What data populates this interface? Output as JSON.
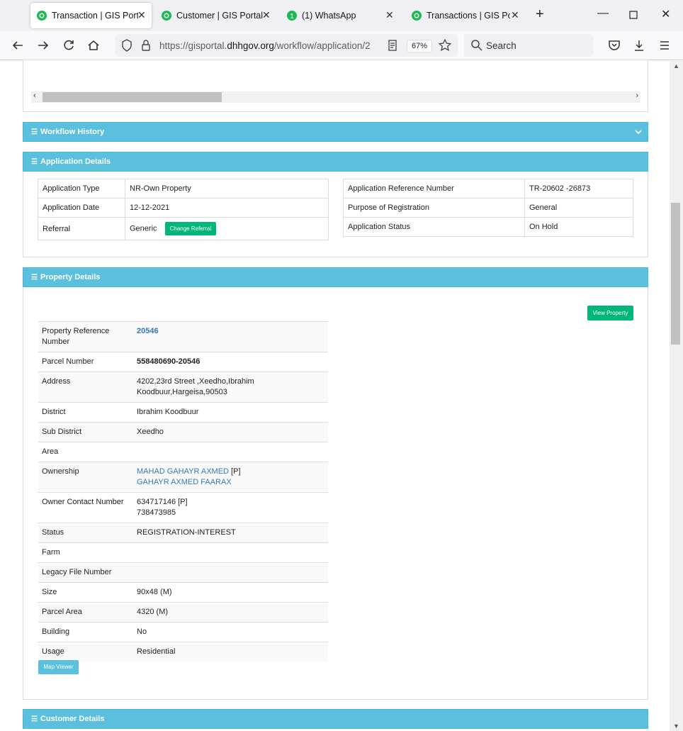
{
  "tabs": [
    {
      "title": "Transaction | GIS Portal",
      "active": true
    },
    {
      "title": "Customer | GIS Portal",
      "active": false
    },
    {
      "title": "(1) WhatsApp",
      "active": false,
      "badge": "1"
    },
    {
      "title": "Transactions | GIS Portal",
      "active": false
    }
  ],
  "address_bar": {
    "url_prefix": "https://gisportal.",
    "url_domain": "dhhgov.org",
    "url_path": "/workflow/application/2",
    "zoom": "67%"
  },
  "search": {
    "placeholder": "Search"
  },
  "workflow_history": {
    "title": "Workflow History"
  },
  "application_details": {
    "title": "Application Details",
    "left": [
      {
        "label": "Application Type",
        "value": "NR-Own Property"
      },
      {
        "label": "Application Date",
        "value": "12-12-2021"
      },
      {
        "label": "Referral",
        "value": "Generic",
        "button": "Change Referral"
      }
    ],
    "right": [
      {
        "label": "Application Reference Number",
        "value": "TR-20602 -26873"
      },
      {
        "label": "Purpose of Registration",
        "value": "General"
      },
      {
        "label": "Application Status",
        "value": "On Hold"
      }
    ]
  },
  "property_details": {
    "title": "Property Details",
    "view_button": "View Property",
    "map_button": "Map Viewer",
    "rows": [
      {
        "label": "Property Reference Number",
        "value": "20546"
      },
      {
        "label": "Parcel Number",
        "value": "558480690-20546"
      },
      {
        "label": "Address",
        "value": "4202,23rd Street ,Xeedho,Ibrahim Koodbuur,Hargeisa,90503"
      },
      {
        "label": "District",
        "value": "Ibrahim Koodbuur"
      },
      {
        "label": "Sub District",
        "value": "Xeedho"
      },
      {
        "label": "Area",
        "value": ""
      },
      {
        "label": "Ownership",
        "owners": [
          {
            "name": "MAHAD GAHAYR AXMED",
            "tag": " [P]"
          },
          {
            "name": "GAHAYR AXMED FAARAX",
            "tag": ""
          }
        ]
      },
      {
        "label": "Owner Contact Number",
        "contacts": [
          "634717146 [P]",
          "738473985"
        ]
      },
      {
        "label": "Status",
        "value": "REGISTRATION-INTEREST"
      },
      {
        "label": "Farm",
        "value": ""
      },
      {
        "label": "Legacy File Number",
        "value": ""
      },
      {
        "label": "Size",
        "value": "90x48 (M)"
      },
      {
        "label": "Parcel Area",
        "value": "4320 (M)"
      },
      {
        "label": "Building",
        "value": "No"
      },
      {
        "label": "Usage",
        "value": "Residential"
      }
    ]
  },
  "customer_details": {
    "title": "Customer Details"
  },
  "colors": {
    "panel_header": "#5bc0de",
    "button_green": "#00b67a",
    "link": "#337ab7"
  }
}
